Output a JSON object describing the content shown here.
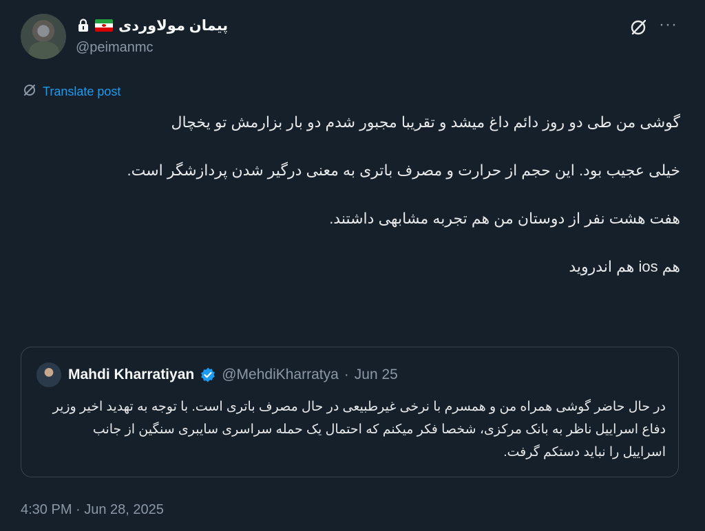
{
  "author": {
    "display_name": "پیمان مولاوردی",
    "handle": "@peimanmc"
  },
  "actions": {
    "more": "···"
  },
  "translate": {
    "label": "Translate post"
  },
  "post": {
    "paragraphs": [
      "گوشی من طی دو روز دائم داغ میشد و تقریبا مجبور شدم دو بار بزارمش تو یخچال",
      "خیلی عجیب بود. این حجم از حرارت و مصرف باتری به معنی درگیر شدن پردازشگر است.",
      "هفت هشت نفر از دوستان من هم تجربه مشابهی داشتند.",
      "هم ios هم اندروید"
    ]
  },
  "quote": {
    "name": "Mahdi Kharratiyan",
    "handle": "@MehdiKharratya",
    "separator": "·",
    "date": "Jun 25",
    "text": "در حال حاضر گوشی همراه من و همسرم با نرخی غیرطبیعی در حال مصرف باتری است. با توجه به تهدید اخیر وزیر دفاع اسراییل ناظر به بانک مرکزی، شخصا فکر میکنم که احتمال یک حمله سراسری سایبری سنگین از جانب اسراییل را نباید دستکم گرفت."
  },
  "timestamp": "4:30 PM · Jun 28, 2025",
  "colors": {
    "background": "#15202b",
    "accent": "#1d9bf0",
    "muted": "#8b98a5",
    "border": "#38444d"
  }
}
